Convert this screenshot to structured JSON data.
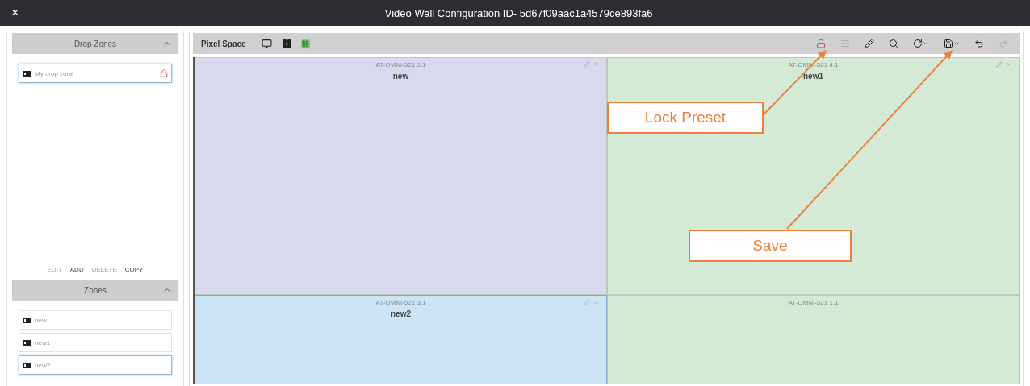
{
  "window": {
    "title": "Video Wall Configuration ID- 5d67f09aac1a4579ce893fa6",
    "close": "×"
  },
  "sidebar": {
    "drop_zones": {
      "title": "Drop Zones",
      "expanded": true,
      "items": [
        {
          "name": "My drop zone",
          "selected": true,
          "locked": true
        }
      ],
      "actions": [
        {
          "label": "EDIT",
          "disabled": true
        },
        {
          "label": "ADD",
          "disabled": false
        },
        {
          "label": "DELETE",
          "disabled": true
        },
        {
          "label": "COPY",
          "disabled": false
        }
      ]
    },
    "zones": {
      "title": "Zones",
      "expanded": true,
      "items": [
        {
          "name": "new",
          "selected": false
        },
        {
          "name": "new1",
          "selected": false
        },
        {
          "name": "new2",
          "selected": true
        }
      ]
    }
  },
  "toolbar": {
    "title": "Pixel Space",
    "views": [
      {
        "kind": "monitor",
        "selected": false
      },
      {
        "kind": "grid",
        "selected": false
      },
      {
        "kind": "matrix",
        "selected": true
      }
    ],
    "tools": [
      {
        "kind": "lock",
        "on": true,
        "disabled": false
      },
      {
        "kind": "list",
        "on": false,
        "disabled": true
      },
      {
        "kind": "pencil",
        "on": false,
        "disabled": false
      },
      {
        "kind": "search",
        "on": false,
        "disabled": false
      },
      {
        "kind": "rotate",
        "on": false,
        "disabled": false
      },
      {
        "kind": "save",
        "on": false,
        "disabled": false
      },
      {
        "kind": "undo",
        "on": false,
        "disabled": false
      },
      {
        "kind": "redo",
        "on": false,
        "disabled": true
      }
    ]
  },
  "tiles": [
    {
      "header": "AT-OMNI-521 2.1",
      "name": "new",
      "color": "#d8d9ee",
      "selected": false
    },
    {
      "header": "AT-OMNI-521 4.1",
      "name": "new1",
      "color": "#d5ead6",
      "selected": false
    },
    {
      "header": "AT-OMNI-521 3.1",
      "name": "new2",
      "color": "#cbe3f6",
      "selected": true
    },
    {
      "header": "AT-OMNI-521 1.1",
      "color": "#d5ead6",
      "selected": false
    }
  ],
  "callouts": [
    {
      "label": "Lock Preset"
    },
    {
      "label": "Save"
    }
  ]
}
